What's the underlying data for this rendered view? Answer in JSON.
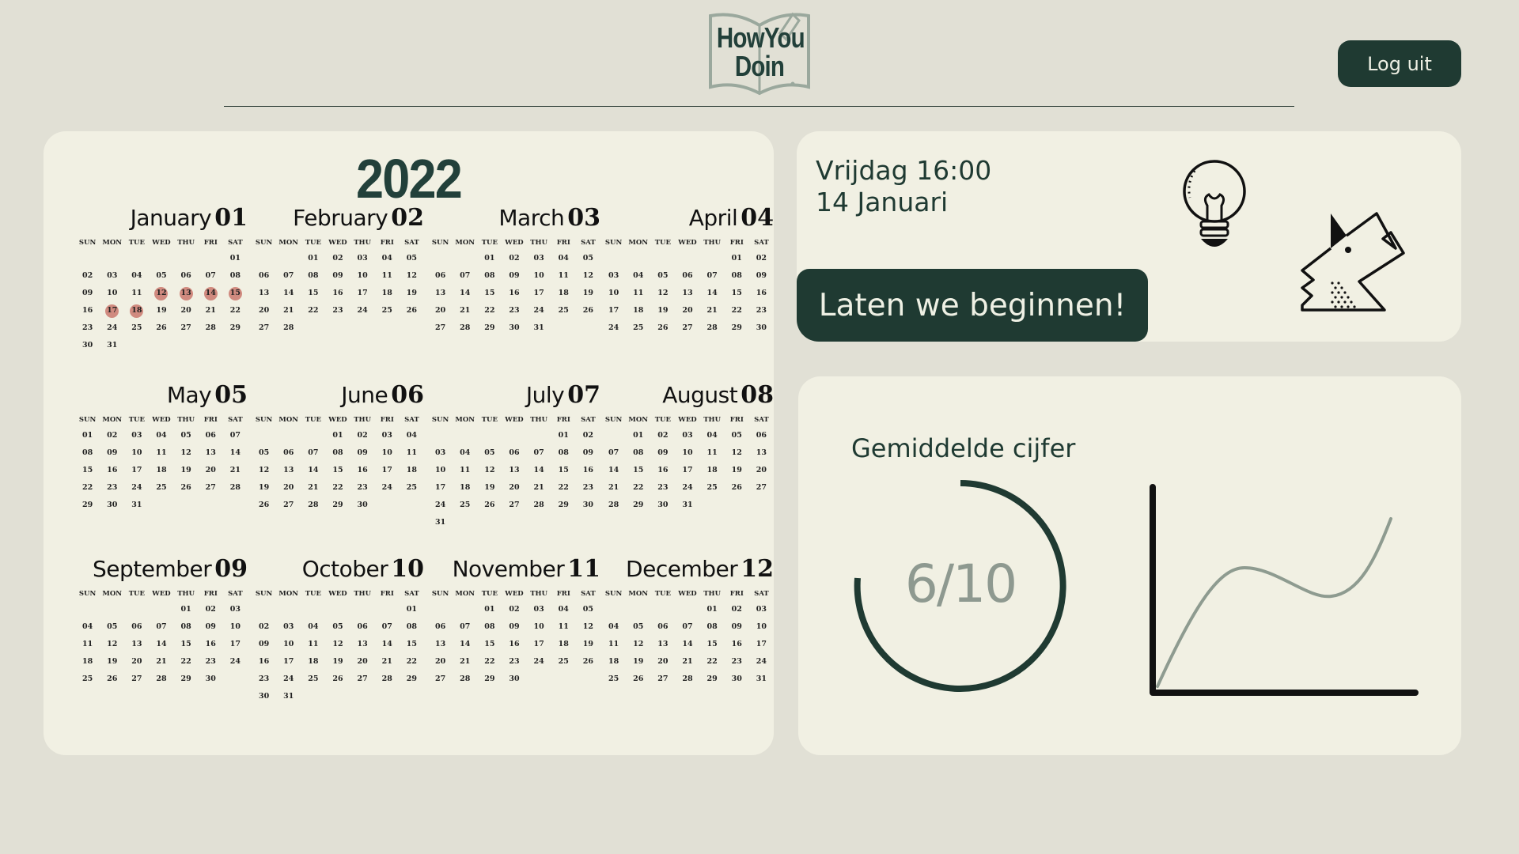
{
  "header": {
    "logo_line1_left": "How",
    "logo_line1_right": "You",
    "logo_line2": "Doin",
    "logout_label": "Log uit"
  },
  "calendar": {
    "year": "2022",
    "weekday_labels": [
      "SUN",
      "MON",
      "TUE",
      "WED",
      "THU",
      "FRI",
      "SAT"
    ],
    "highlight_color": "#d08a7f",
    "months": [
      {
        "name": "January",
        "num": "01",
        "start": 6,
        "days": 31,
        "highlight": [
          12,
          13,
          14,
          15,
          17,
          18
        ]
      },
      {
        "name": "February",
        "num": "02",
        "start": 2,
        "days": 28,
        "highlight": []
      },
      {
        "name": "March",
        "num": "03",
        "start": 2,
        "days": 31,
        "highlight": []
      },
      {
        "name": "April",
        "num": "04",
        "start": 5,
        "days": 30,
        "highlight": []
      },
      {
        "name": "May",
        "num": "05",
        "start": 0,
        "days": 31,
        "highlight": []
      },
      {
        "name": "June",
        "num": "06",
        "start": 3,
        "days": 30,
        "highlight": []
      },
      {
        "name": "July",
        "num": "07",
        "start": 5,
        "days": 31,
        "highlight": []
      },
      {
        "name": "August",
        "num": "08",
        "start": 1,
        "days": 31,
        "highlight": []
      },
      {
        "name": "September",
        "num": "09",
        "start": 4,
        "days": 30,
        "highlight": []
      },
      {
        "name": "October",
        "num": "10",
        "start": 6,
        "days": 31,
        "highlight": []
      },
      {
        "name": "November",
        "num": "11",
        "start": 2,
        "days": 30,
        "highlight": []
      },
      {
        "name": "December",
        "num": "12",
        "start": 4,
        "days": 31,
        "highlight": []
      }
    ]
  },
  "info": {
    "time_line": "Vrijdag 16:00",
    "date_line": "14 Januari",
    "start_button": "Laten we beginnen!",
    "illustrations": [
      "lightbulb-icon",
      "dog-icon"
    ]
  },
  "grade": {
    "title": "Gemiddelde cijfer",
    "value_text": "6/10",
    "value": 6,
    "max": 10,
    "accent_color": "#1f3a32",
    "trend_color": "#8e9b90"
  }
}
